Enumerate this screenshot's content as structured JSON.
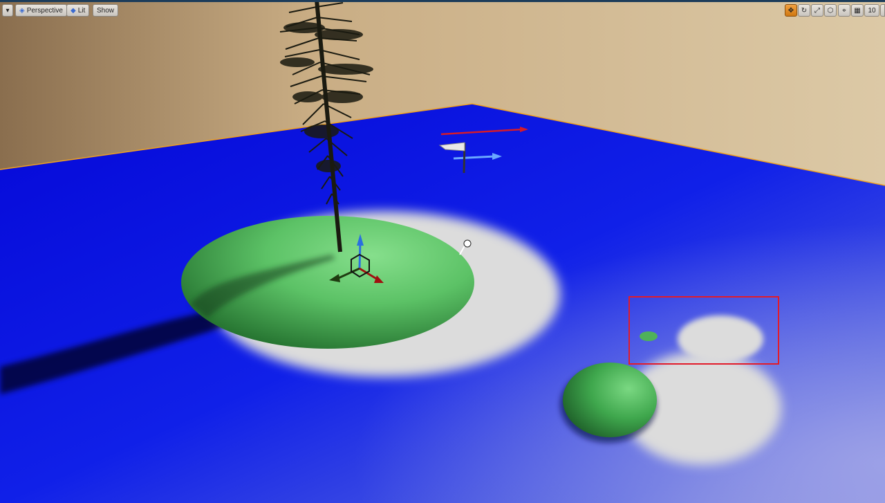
{
  "toolbar": {
    "menu_icon": "chevron-down-icon",
    "perspective_label": "Perspective",
    "lit_label": "Lit",
    "show_label": "Show",
    "right_buttons": [
      "translate-icon",
      "rotate-icon",
      "scale-icon",
      "world-local-icon",
      "surface-snap-icon",
      "grid-snap-icon"
    ],
    "grid_size": "10"
  },
  "colors": {
    "floor": "#0a12e8",
    "wall": "#d9c29a",
    "terrain": "#5ec46a",
    "selection": "#e21b2a"
  }
}
